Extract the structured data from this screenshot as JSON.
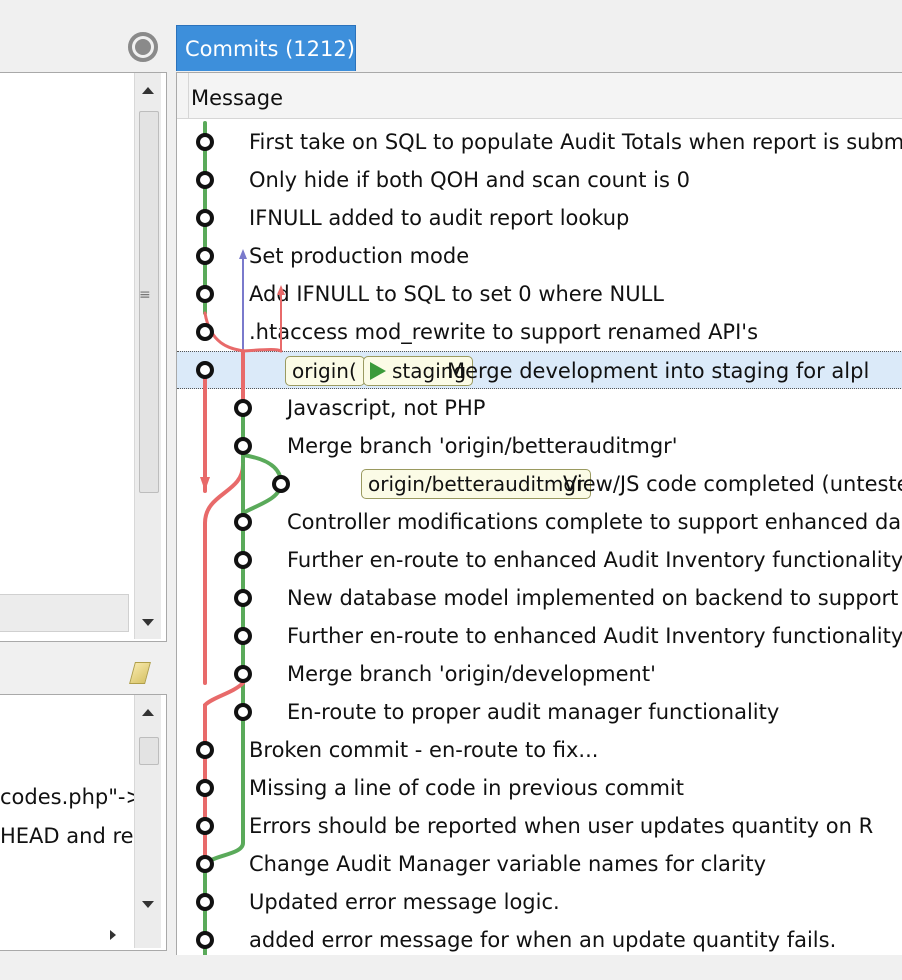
{
  "window": {
    "commits_tab_label": "Commits (1212)",
    "github_icon": "github-icon"
  },
  "left_panel": {
    "code_lines": [
      "codes.php\"->",
      "HEAD and rer"
    ]
  },
  "commits": {
    "column_header": "Message",
    "items": [
      {
        "message": "First take on SQL to populate Audit Totals when report is subm",
        "lane": 0
      },
      {
        "message": "Only hide if both QOH and scan count is 0",
        "lane": 0
      },
      {
        "message": "IFNULL added to audit report lookup",
        "lane": 0
      },
      {
        "message": "Set production mode",
        "lane": 0
      },
      {
        "message": "Add IFNULL to SQL to set 0 where NULL",
        "lane": 0
      },
      {
        "message": ".htaccess mod_rewrite to support renamed API's",
        "lane": 0
      },
      {
        "message": "Merge development into staging for alpl",
        "lane": 0,
        "tags": [
          "origin(",
          "staging"
        ],
        "selected": true
      },
      {
        "message": "Javascript, not PHP",
        "lane": 1
      },
      {
        "message": "Merge branch 'origin/betterauditmgr'",
        "lane": 1
      },
      {
        "message": "View/JS code completed (unteste",
        "lane": 2,
        "tags": [
          "origin/betterauditmgr"
        ]
      },
      {
        "message": "Controller modifications complete to support enhanced da",
        "lane": 1
      },
      {
        "message": "Further en-route to enhanced Audit Inventory functionality",
        "lane": 1
      },
      {
        "message": "New database model implemented on backend to support",
        "lane": 1
      },
      {
        "message": "Further en-route to enhanced Audit Inventory functionality",
        "lane": 1
      },
      {
        "message": "Merge branch 'origin/development'",
        "lane": 1
      },
      {
        "message": "En-route to proper audit manager functionality",
        "lane": 1
      },
      {
        "message": "Broken commit - en-route to fix...",
        "lane": 0
      },
      {
        "message": "Missing a line of code in previous commit",
        "lane": 0
      },
      {
        "message": "Errors should be reported when user updates quantity on R",
        "lane": 0
      },
      {
        "message": "Change Audit Manager variable names for clarity",
        "lane": 0
      },
      {
        "message": "Updated error message logic.",
        "lane": 0
      },
      {
        "message": "added error message for when an update quantity fails.",
        "lane": 0
      }
    ]
  },
  "colors": {
    "tab_blue": "#3d8fdb",
    "branch_green": "#5aaa5a",
    "branch_red": "#e86a6a",
    "branch_blue": "#7a7acc",
    "staging_arrow": "#3a9a3a",
    "tag_bg": "#fbfbe6",
    "selection": "#dbeaf9"
  }
}
